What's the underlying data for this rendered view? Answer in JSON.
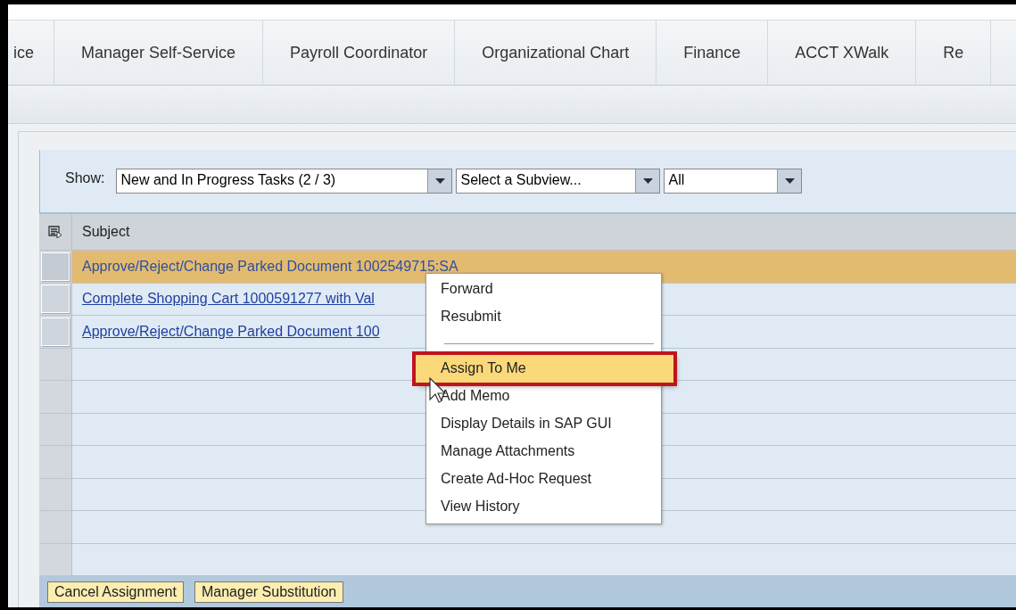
{
  "tabs": [
    {
      "label": "ice",
      "selected": false
    },
    {
      "label": "Manager Self-Service",
      "selected": false
    },
    {
      "label": "Payroll Coordinator",
      "selected": false
    },
    {
      "label": "Organizational Chart",
      "selected": false
    },
    {
      "label": "Finance",
      "selected": false
    },
    {
      "label": "ACCT XWalk",
      "selected": false
    },
    {
      "label": "Re",
      "selected": false
    }
  ],
  "filter": {
    "label": "Show:",
    "dropdowns": [
      {
        "value": "New and In Progress Tasks  (2 / 3)"
      },
      {
        "value": "Select a Subview..."
      },
      {
        "value": "All"
      }
    ]
  },
  "table": {
    "columns": [
      "Subject"
    ],
    "rows": [
      {
        "subject": "Approve/Reject/Change Parked Document 1002549715:SA",
        "selected": true,
        "link": false
      },
      {
        "subject": "Complete Shopping Cart 1000591277 with Val",
        "selected": false,
        "link": true
      },
      {
        "subject": "Approve/Reject/Change Parked Document 100",
        "selected": false,
        "link": true
      }
    ]
  },
  "context_menu": {
    "items": [
      {
        "kind": "item",
        "label": "Forward",
        "highlighted": false,
        "callout": false
      },
      {
        "kind": "item",
        "label": "Resubmit",
        "highlighted": false,
        "callout": false
      },
      {
        "kind": "separator"
      },
      {
        "kind": "item",
        "label": "Assign To Me",
        "highlighted": true,
        "callout": true
      },
      {
        "kind": "item",
        "label": "Add Memo",
        "highlighted": false,
        "callout": false
      },
      {
        "kind": "item",
        "label": "Display Details in SAP GUI",
        "highlighted": false,
        "callout": false
      },
      {
        "kind": "item",
        "label": "Manage Attachments",
        "highlighted": false,
        "callout": false
      },
      {
        "kind": "item",
        "label": "Create Ad-Hoc Request",
        "highlighted": false,
        "callout": false
      },
      {
        "kind": "item",
        "label": "View History",
        "highlighted": false,
        "callout": false
      }
    ]
  },
  "buttons": [
    "Cancel Assignment",
    "Manager Substitution"
  ]
}
